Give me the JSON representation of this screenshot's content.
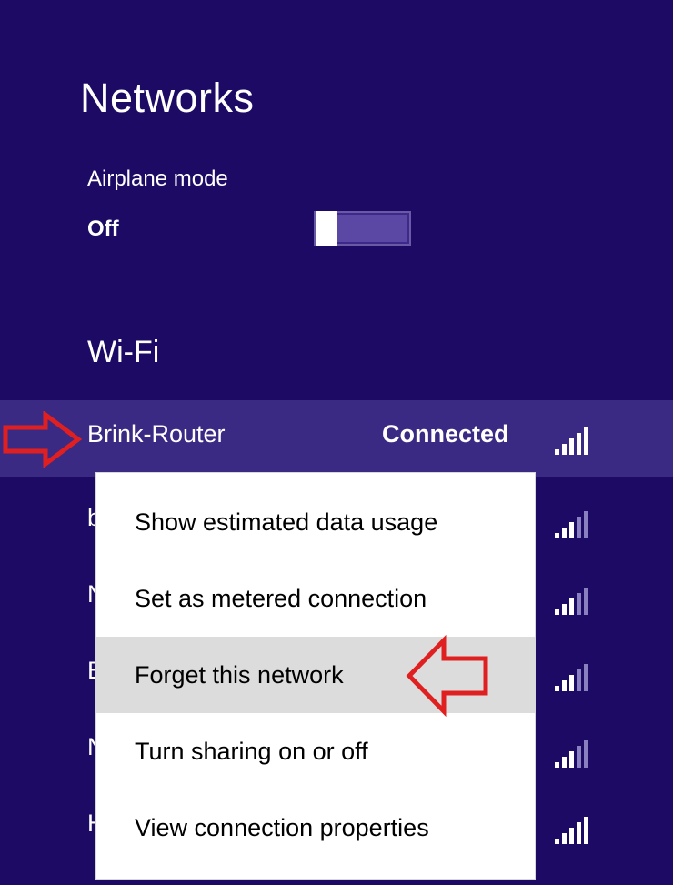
{
  "panel": {
    "title": "Networks",
    "airplane_mode": {
      "label": "Airplane mode",
      "state": "Off"
    },
    "wifi_heading": "Wi-Fi",
    "connected_network": {
      "ssid": "Brink-Router",
      "status": "Connected",
      "signal_icon": "signal-bars-icon"
    },
    "other_networks": [
      {
        "initial": "b",
        "signal_icon": "signal-bars-icon"
      },
      {
        "initial": "N",
        "signal_icon": "signal-bars-icon"
      },
      {
        "initial": "E",
        "signal_icon": "signal-bars-icon"
      },
      {
        "initial": "N",
        "signal_icon": "signal-bars-icon"
      },
      {
        "initial": "H",
        "signal_icon": "signal-bars-icon"
      }
    ]
  },
  "context_menu": {
    "items": [
      {
        "label": "Show estimated data usage"
      },
      {
        "label": "Set as metered connection"
      },
      {
        "label": "Forget this network",
        "highlighted": true
      },
      {
        "label": "Turn sharing on or off"
      },
      {
        "label": "View connection properties"
      }
    ]
  },
  "annotations": {
    "arrow_color": "#e02020",
    "arrow_icon": "red-outline-arrow-icon"
  },
  "colors": {
    "panel_background": "#1c0a64",
    "selected_row": "#3b2a84",
    "menu_highlight": "#dcdcdc"
  }
}
